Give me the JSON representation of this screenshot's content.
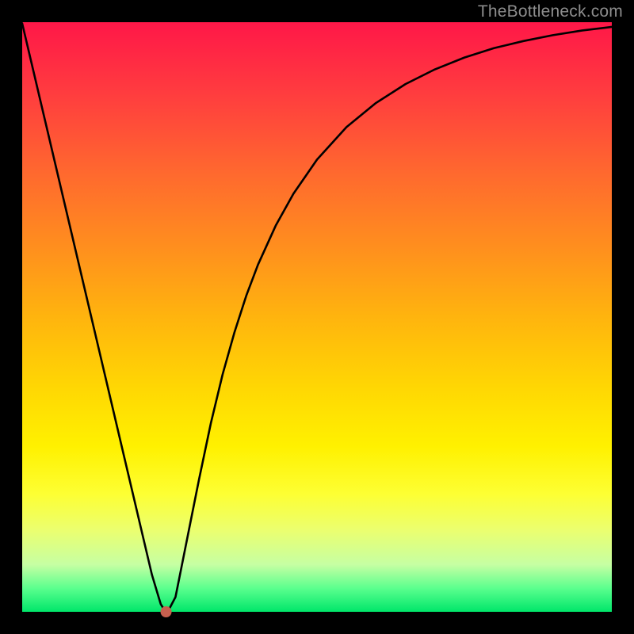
{
  "watermark": "TheBottleneck.com",
  "chart_data": {
    "type": "line",
    "title": "",
    "xlabel": "",
    "ylabel": "",
    "xlim": [
      0,
      100
    ],
    "ylim": [
      0,
      100
    ],
    "grid": false,
    "background": "rainbow-vertical-gradient",
    "series": [
      {
        "name": "bottleneck-curve",
        "x": [
          0,
          2,
          4,
          6,
          8,
          10,
          12,
          14,
          16,
          18,
          20,
          22,
          23.5,
          24,
          24.5,
          25,
          26,
          27,
          28.5,
          30,
          32,
          34,
          36,
          38,
          40,
          43,
          46,
          50,
          55,
          60,
          65,
          70,
          75,
          80,
          85,
          90,
          95,
          100
        ],
        "y": [
          99.8,
          91.3,
          82.8,
          74.3,
          65.8,
          57.3,
          48.8,
          40.3,
          31.8,
          23.3,
          14.8,
          6.3,
          1.3,
          0.5,
          0.4,
          0.6,
          2.5,
          7.5,
          15.0,
          22.5,
          32.0,
          40.3,
          47.4,
          53.6,
          58.9,
          65.5,
          70.9,
          76.7,
          82.2,
          86.3,
          89.5,
          92.0,
          94.0,
          95.6,
          96.8,
          97.8,
          98.6,
          99.2
        ]
      }
    ],
    "min_point": {
      "x": 24.4,
      "y": 0
    },
    "colors": {
      "curve": "#000000",
      "dot": "#c7604f",
      "frame": "#000000"
    }
  }
}
